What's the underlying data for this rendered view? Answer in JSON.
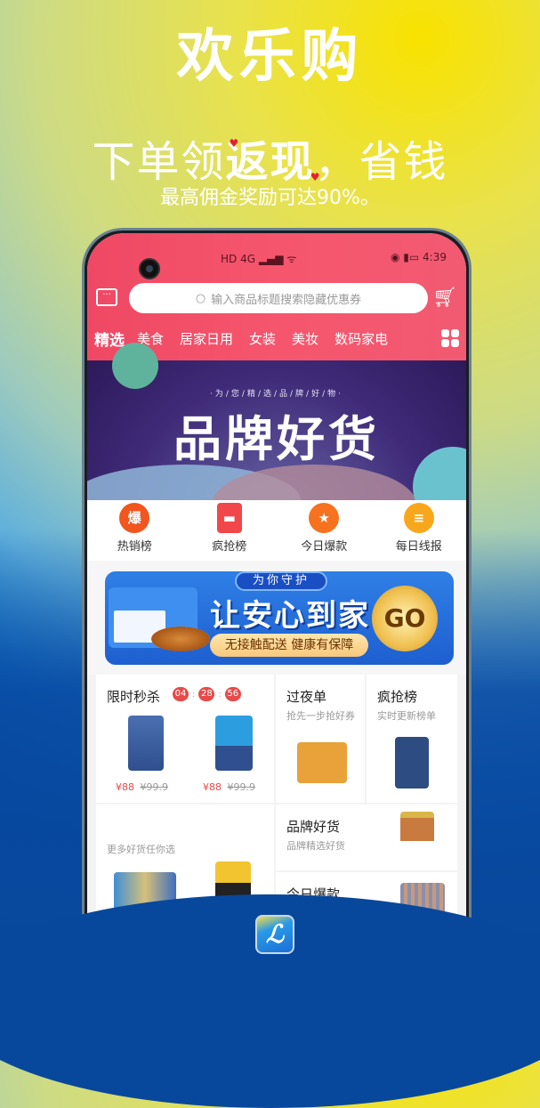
{
  "promo": {
    "title": "欢乐购",
    "slogan_part1": "下单领",
    "slogan_highlight": "返现",
    "slogan_part2": "，省钱",
    "subtitle": "最高佣金奖励可达90%。"
  },
  "status_bar": {
    "left": "HD 4G ▂▄▆ ᯤ",
    "time": "4:39",
    "battery_icon": "battery-icon",
    "eye_icon": "eye-icon"
  },
  "header": {
    "message_icon": "message-icon",
    "search_placeholder": "输入商品标题搜索隐藏优惠券",
    "cart_icon": "cart-icon"
  },
  "categories": [
    {
      "label": "精选",
      "selected": true
    },
    {
      "label": "美食"
    },
    {
      "label": "居家日用"
    },
    {
      "label": "女装"
    },
    {
      "label": "美妆"
    },
    {
      "label": "数码家电"
    }
  ],
  "banner": {
    "subtitle": "·为/您/精/选/品/牌/好/物·",
    "title": "品牌好货"
  },
  "quick_icons": [
    {
      "label": "热销榜",
      "glyph": "爆",
      "color": "#f0561e"
    },
    {
      "label": "疯抢榜",
      "glyph": "▬",
      "color": "#f2474a"
    },
    {
      "label": "今日爆款",
      "glyph": "★",
      "color": "#f6721e"
    },
    {
      "label": "每日线报",
      "glyph": "≡",
      "color": "#f8a71c"
    }
  ],
  "promo_banner": {
    "tag": "为你守护",
    "title": "让安心到家",
    "pill": "无接触配送 健康有保障",
    "go": "GO"
  },
  "flash_sale": {
    "title": "限时秒杀",
    "timer": [
      "04",
      "28",
      "56"
    ],
    "items": [
      {
        "price": "¥88",
        "original": "¥99.9"
      },
      {
        "price": "¥88",
        "original": "¥99.9"
      }
    ]
  },
  "cards": {
    "overnight": {
      "title": "过夜单",
      "subtitle": "抢先一步抢好券"
    },
    "rush": {
      "title": "疯抢榜",
      "subtitle": "实时更新榜单"
    },
    "more": {
      "subtitle": "更多好货任你选"
    },
    "brand": {
      "title": "品牌好货",
      "subtitle": "品牌精选好货"
    },
    "today": {
      "title": "今日爆款"
    }
  },
  "app_logo": "ℒ"
}
